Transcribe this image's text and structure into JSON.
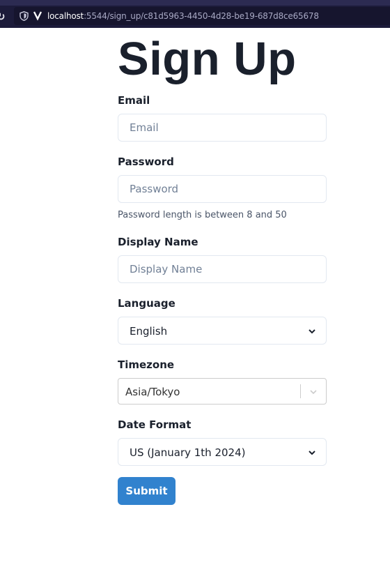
{
  "browser": {
    "url_host": "localhost",
    "url_rest": ":5544/sign_up/c81d5963-4450-4d28-be19-687d8ce65678"
  },
  "form": {
    "title": "Sign Up",
    "email": {
      "label": "Email",
      "placeholder": "Email",
      "value": ""
    },
    "password": {
      "label": "Password",
      "placeholder": "Password",
      "value": "",
      "helper": "Password length is between 8 and 50"
    },
    "display_name": {
      "label": "Display Name",
      "placeholder": "Display Name",
      "value": ""
    },
    "language": {
      "label": "Language",
      "value": "English"
    },
    "timezone": {
      "label": "Timezone",
      "value": "Asia/Tokyo"
    },
    "date_format": {
      "label": "Date Format",
      "value": "US (January 1th 2024)"
    },
    "submit_label": "Submit"
  },
  "icons": {
    "reload": "reload-icon",
    "shield": "shield-icon",
    "chevron": "chevron-down-icon"
  },
  "colors": {
    "browser_bar": "#1c1b3a",
    "primary_button": "#3182ce",
    "title_text": "#1a202c"
  }
}
